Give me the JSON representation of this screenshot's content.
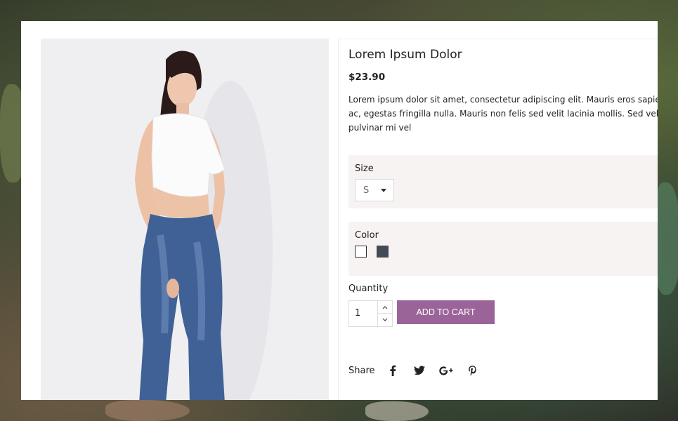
{
  "product": {
    "title": "Lorem Ipsum Dolor",
    "price": "$23.90",
    "description": "Lorem ipsum dolor sit amet, consectetur adipiscing elit. Mauris eros sapien, ac, egestas fringilla nulla. Mauris non felis sed velit lacinia mollis. Sed vel e pulvinar mi vel"
  },
  "size": {
    "label": "Size",
    "selected": "S"
  },
  "color": {
    "label": "Color",
    "swatches": [
      {
        "name": "white",
        "hex": "#ffffff"
      },
      {
        "name": "dark-gray",
        "hex": "#434a57"
      }
    ]
  },
  "quantity": {
    "label": "Quantity",
    "value": "1"
  },
  "cart": {
    "add_label": "ADD TO CART",
    "button_color": "#9b6499"
  },
  "share": {
    "label": "Share",
    "icons": [
      "facebook-icon",
      "twitter-icon",
      "google-plus-icon",
      "pinterest-icon"
    ]
  }
}
